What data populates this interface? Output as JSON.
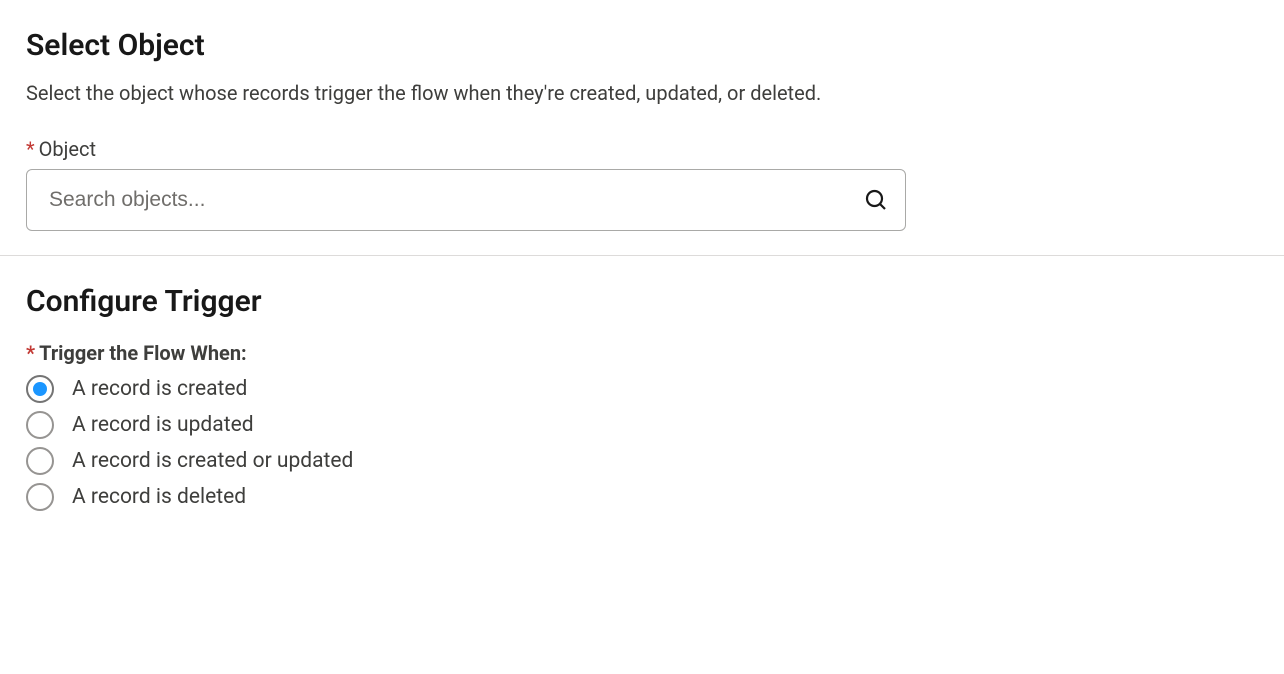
{
  "selectObject": {
    "title": "Select Object",
    "description": "Select the object whose records trigger the flow when they're created, updated, or deleted.",
    "fieldLabel": "Object",
    "required": "*",
    "placeholder": "Search objects..."
  },
  "configureTrigger": {
    "title": "Configure Trigger",
    "label": "Trigger the Flow When:",
    "required": "*",
    "options": [
      {
        "label": "A record is created",
        "selected": true
      },
      {
        "label": "A record is updated",
        "selected": false
      },
      {
        "label": "A record is created or updated",
        "selected": false
      },
      {
        "label": "A record is deleted",
        "selected": false
      }
    ]
  }
}
